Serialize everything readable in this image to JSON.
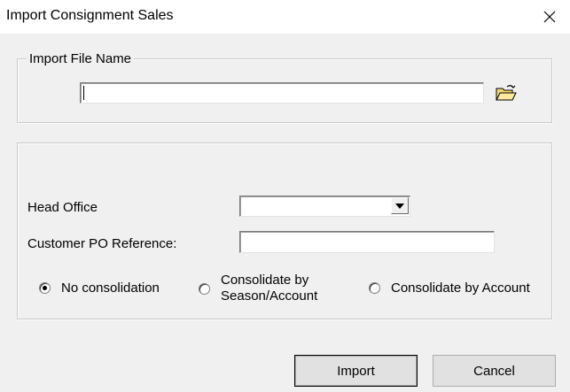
{
  "window": {
    "title": "Import Consignment Sales",
    "close_icon": "close-icon"
  },
  "file_group": {
    "legend": "Import File Name",
    "file_value": "",
    "browse_icon": "open-folder-icon"
  },
  "options_group": {
    "head_office_label": "Head Office",
    "head_office_value": "",
    "po_label": "Customer PO Reference:",
    "po_value": "",
    "consolidation": {
      "selected": "No consolidation",
      "options": [
        {
          "label": "No consolidation",
          "checked": true
        },
        {
          "label": "Consolidate by Season/Account",
          "line1": "Consolidate by",
          "line2": "Season/Account",
          "checked": false
        },
        {
          "label": "Consolidate by Account",
          "checked": false
        }
      ]
    }
  },
  "buttons": {
    "import_label": "Import",
    "cancel_label": "Cancel"
  }
}
